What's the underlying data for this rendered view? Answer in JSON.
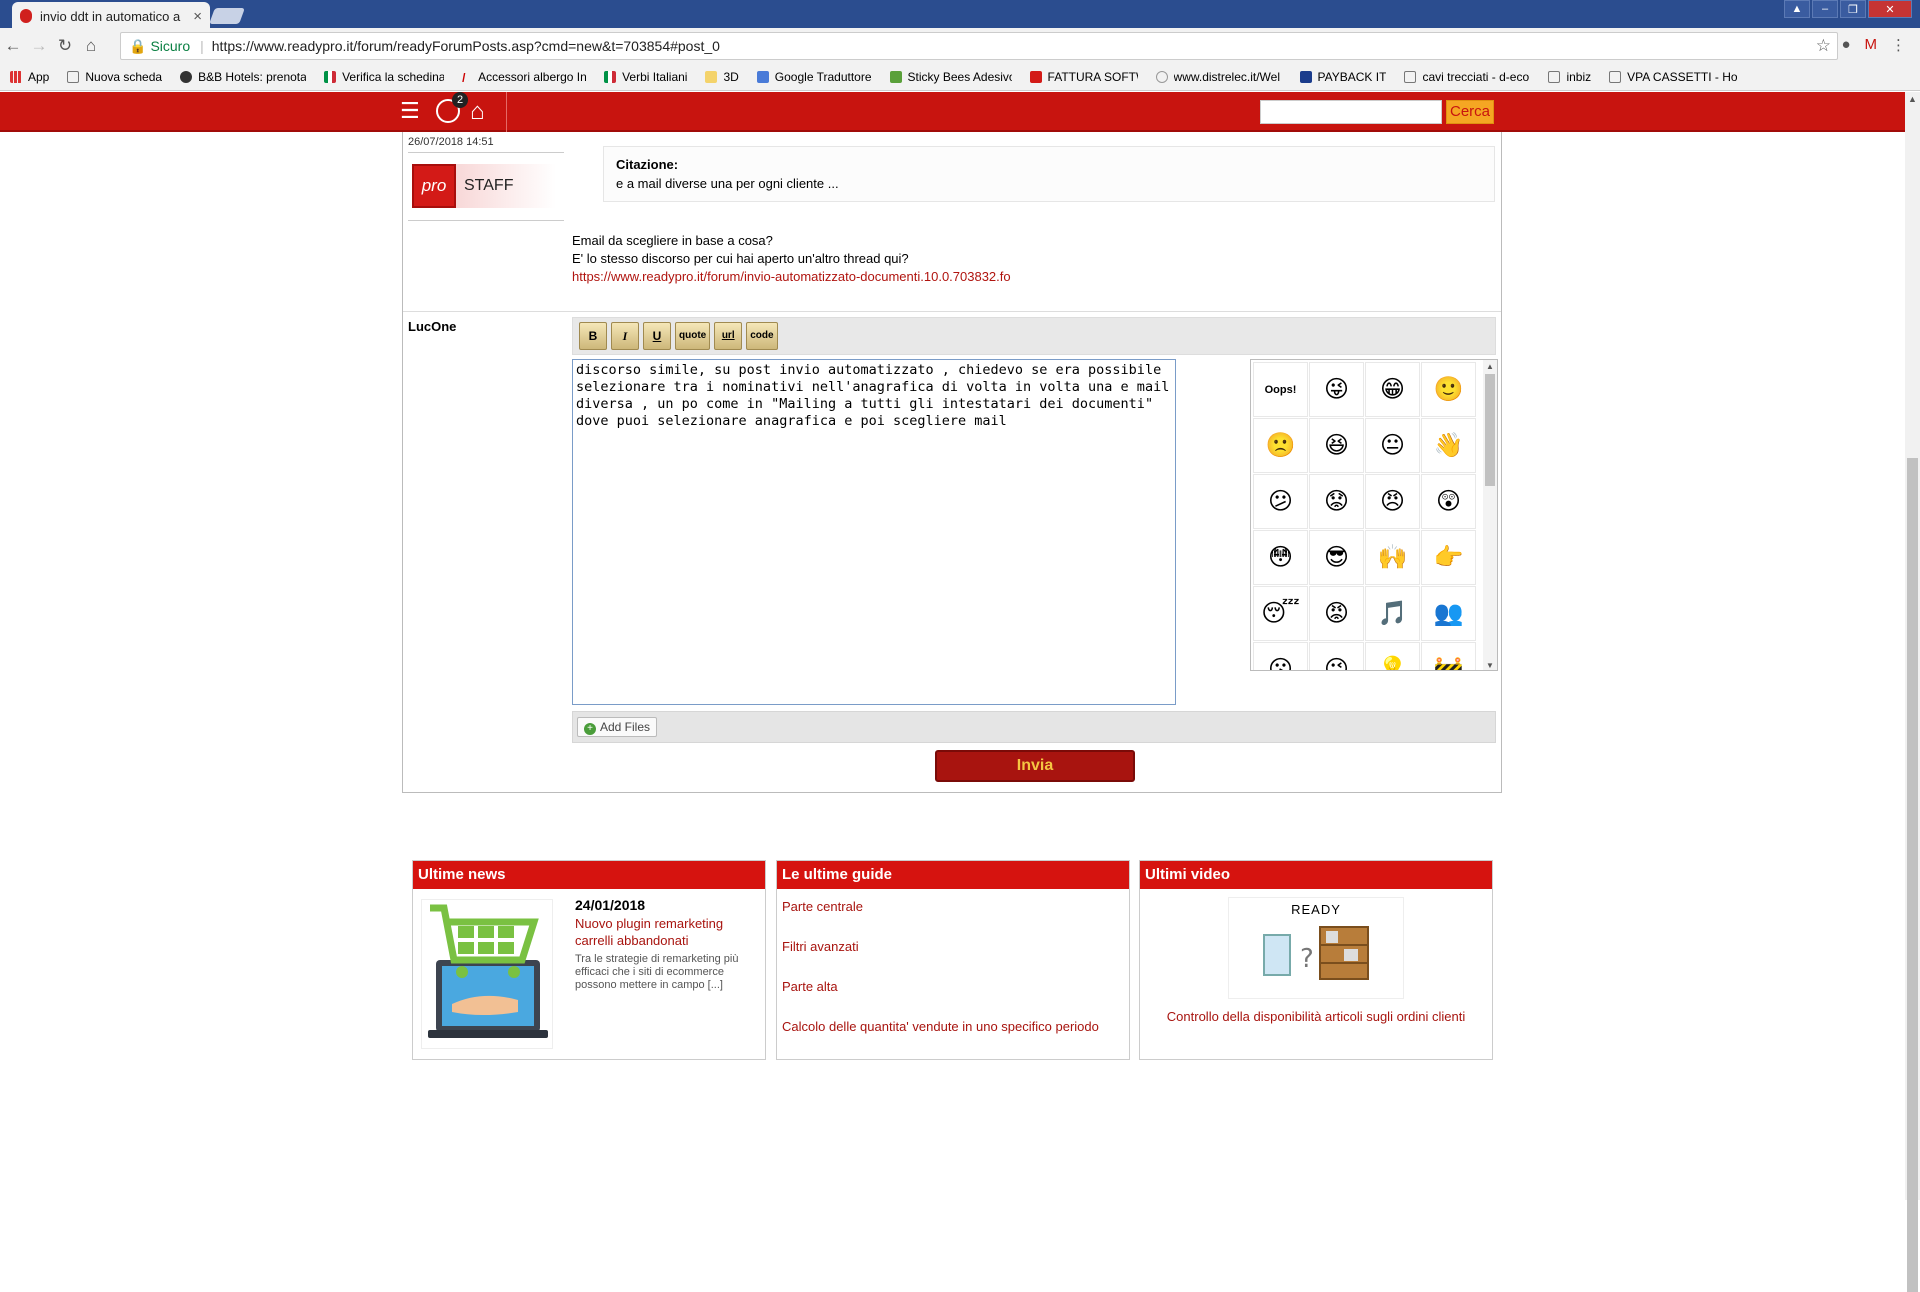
{
  "browser": {
    "tab_title": "invio ddt in automatico a",
    "secure_label": "Sicuro",
    "url": "https://www.readypro.it/forum/readyForumPosts.asp?cmd=new&t=703854#post_0",
    "bookmarks": [
      "App",
      "Nuova scheda",
      "B&B Hotels: prenota",
      "Verifica la schedina",
      "Accessori albergo In",
      "Verbi Italiani",
      "3D",
      "Google Traduttore",
      "Sticky Bees Adesivo",
      "FATTURA SOFTWA",
      "www.distrelec.it/Wel",
      "PAYBACK IT",
      "cavi trecciati - d-eco",
      "inbiz",
      "VPA CASSETTI - Hom"
    ]
  },
  "header": {
    "badge_count": "2",
    "search_placeholder": "",
    "search_button": "Cerca"
  },
  "post1": {
    "date": "26/07/2018 14:51",
    "logo": "pro",
    "role": "STAFF",
    "quote_label": "Citazione:",
    "quote_text": "e a mail diverse una per ogni cliente ...",
    "line1": "Email da scegliere in base a cosa?",
    "line2": "E' lo stesso discorso per cui hai aperto un'altro thread qui?",
    "link": "https://www.readypro.it/forum/invio-automatizzato-documenti.10.0.703832.fo"
  },
  "reply": {
    "username": "LucOne",
    "buttons": [
      "B",
      "I",
      "U",
      "quote",
      "url",
      "code"
    ],
    "text": "discorso simile, su post invio automatizzato , chiedevo se era possibile selezionare tra i nominativi nell'anagrafica di volta in volta una e mail diversa , un po come in \"Mailing a tutti gli intestatari dei documenti\" dove puoi selezionare anagrafica e poi scegliere mail",
    "add_files": "Add Files",
    "submit": "Invia"
  },
  "news": {
    "header": "Ultime news",
    "date": "24/01/2018",
    "title": "Nuovo plugin remarketing carrelli abbandonati",
    "excerpt": "Tra le strategie di remarketing più efficaci che i siti di ecommerce possono mettere in campo [...]"
  },
  "guides": {
    "header": "Le ultime guide",
    "items": [
      "Parte centrale",
      "Filtri avanzati",
      "Parte alta",
      "Calcolo delle quantita' vendute in uno specifico periodo"
    ]
  },
  "videos": {
    "header": "Ultimi video",
    "thumb_label": "READY",
    "title": "Controllo della disponibilità articoli sugli ordini clienti"
  },
  "colors": {
    "brand": "#c8140f",
    "accent": "#f5a623"
  }
}
